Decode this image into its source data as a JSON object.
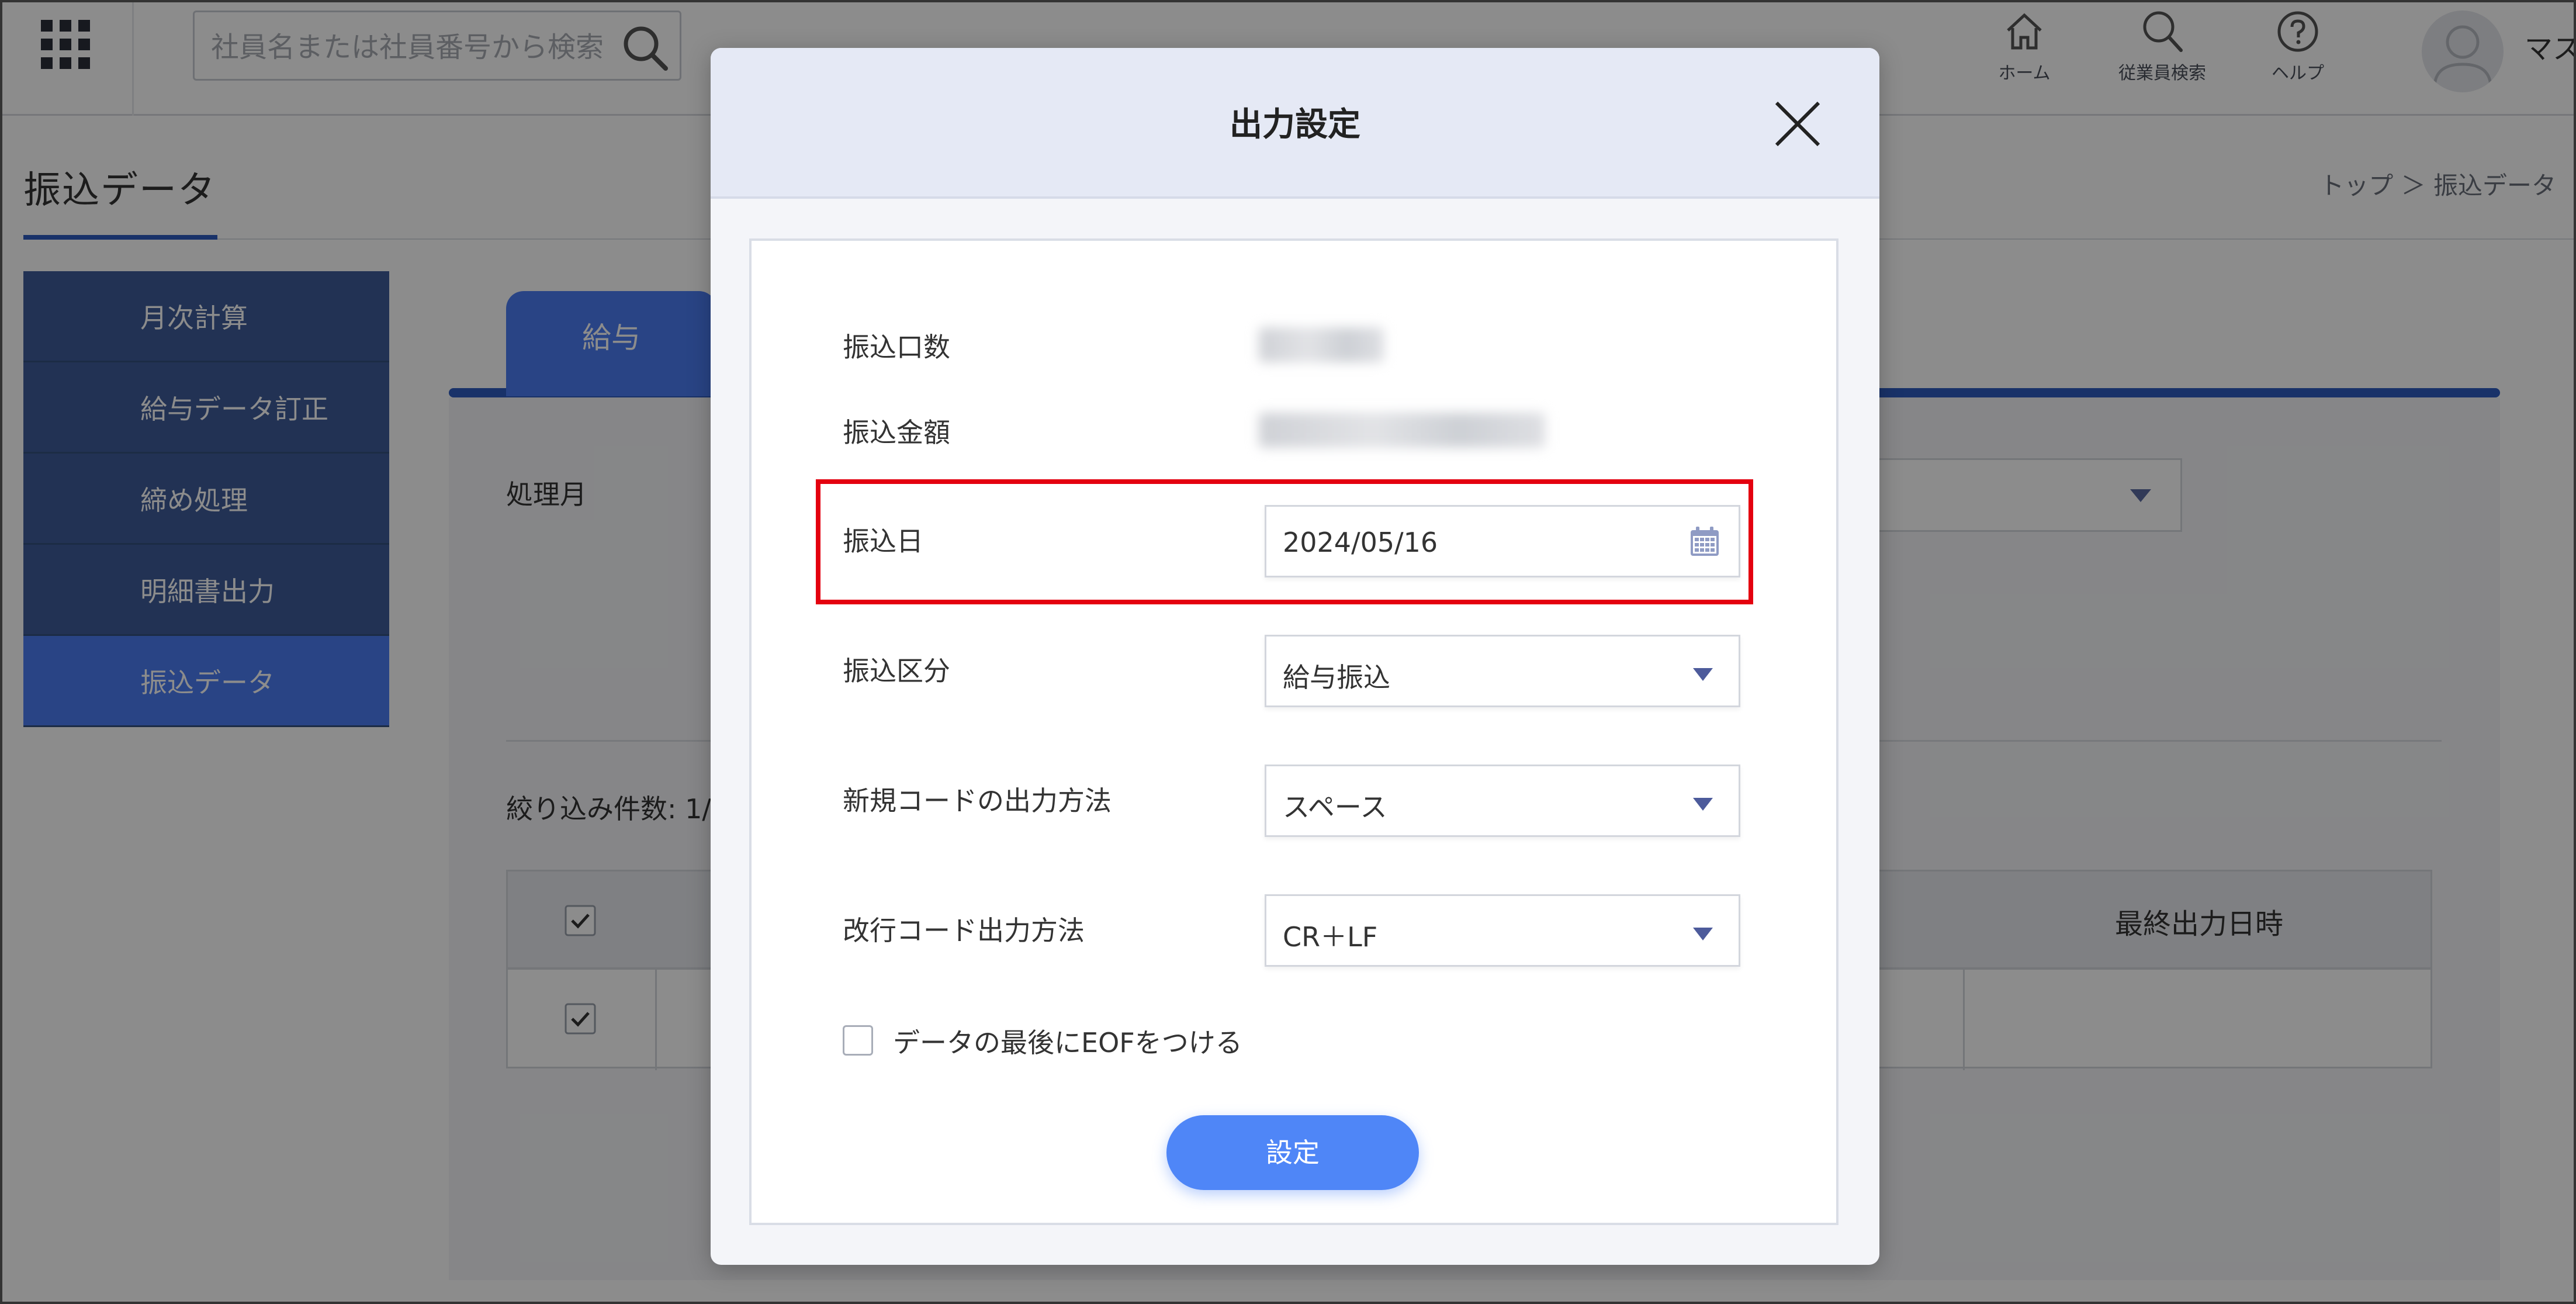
{
  "header": {
    "search_placeholder": "社員名または社員番号から検索",
    "nav": [
      {
        "label": "ホーム",
        "icon": "home-icon"
      },
      {
        "label": "従業員検索",
        "icon": "search-icon"
      },
      {
        "label": "ヘルプ",
        "icon": "help-icon"
      }
    ],
    "username": "マス"
  },
  "page": {
    "title": "振込データ",
    "breadcrumb": "トップ ＞ 振込データ"
  },
  "sidebar": {
    "items": [
      {
        "label": "月次計算"
      },
      {
        "label": "給与データ訂正"
      },
      {
        "label": "締め処理"
      },
      {
        "label": "明細書出力"
      },
      {
        "label": "振込データ",
        "active": true
      }
    ]
  },
  "content": {
    "tab": "給与",
    "process_month_label": "処理月",
    "filter_count_label": "絞り込み件数: 1/",
    "table_header_last": "最終出力日時"
  },
  "modal": {
    "title": "出力設定",
    "rows": {
      "transfer_count_label": "振込口数",
      "transfer_amount_label": "振込金額",
      "transfer_date_label": "振込日",
      "transfer_date_value": "2024/05/16",
      "transfer_type_label": "振込区分",
      "transfer_type_value": "給与振込",
      "new_code_label": "新規コードの出力方法",
      "new_code_value": "スペース",
      "newline_label": "改行コード出力方法",
      "newline_value": "CR＋LF"
    },
    "eof_label": "データの最後にEOFをつける",
    "submit_label": "設定"
  },
  "colors": {
    "accent": "#4f86f7",
    "sidebar": "#3e5c9a",
    "highlight": "#e4000f"
  }
}
